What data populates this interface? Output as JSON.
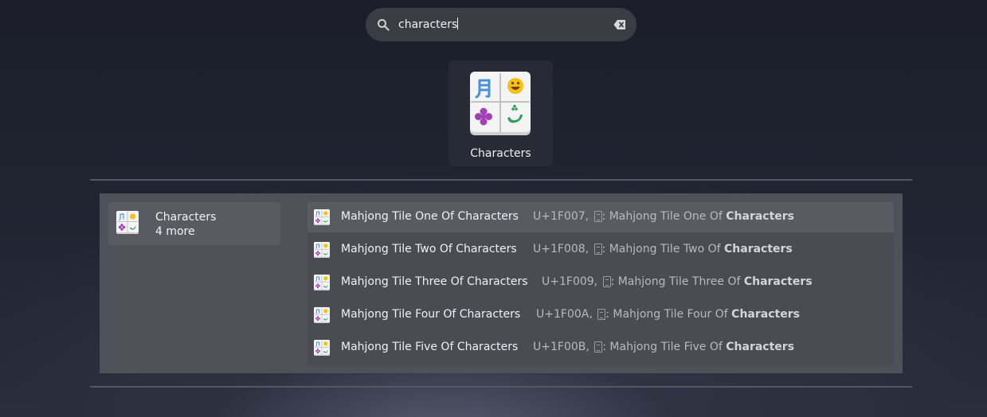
{
  "search": {
    "query": "characters",
    "icons": {
      "search": "magnifier-icon",
      "clear": "clear-backspace-icon"
    }
  },
  "app": {
    "label": "Characters",
    "icon": "characters-app-icon"
  },
  "provider": {
    "name": "Characters",
    "more": "4 more"
  },
  "results": [
    {
      "title": "Mahjong Tile One Of Characters",
      "code": "U+1F007,",
      "desc": ": Mahjong Tile One Of ",
      "desc_bold": "Characters",
      "selected": true
    },
    {
      "title": "Mahjong Tile Two Of Characters",
      "code": "U+1F008,",
      "desc": ": Mahjong Tile Two Of ",
      "desc_bold": "Characters",
      "selected": false
    },
    {
      "title": "Mahjong Tile Three Of Characters",
      "code": "U+1F009,",
      "desc": ": Mahjong Tile Three Of ",
      "desc_bold": "Characters",
      "selected": false
    },
    {
      "title": "Mahjong Tile Four Of Characters",
      "code": "U+1F00A,",
      "desc": ": Mahjong Tile Four Of ",
      "desc_bold": "Characters",
      "selected": false
    },
    {
      "title": "Mahjong Tile Five Of Characters",
      "code": "U+1F00B,",
      "desc": ": Mahjong Tile Five Of ",
      "desc_bold": "Characters",
      "selected": false
    }
  ],
  "colors": {
    "background": "#1c1f2c",
    "search_bg": "#3b3d45",
    "panel_bg": "#4f5058",
    "selected_bg": "#595a62"
  }
}
